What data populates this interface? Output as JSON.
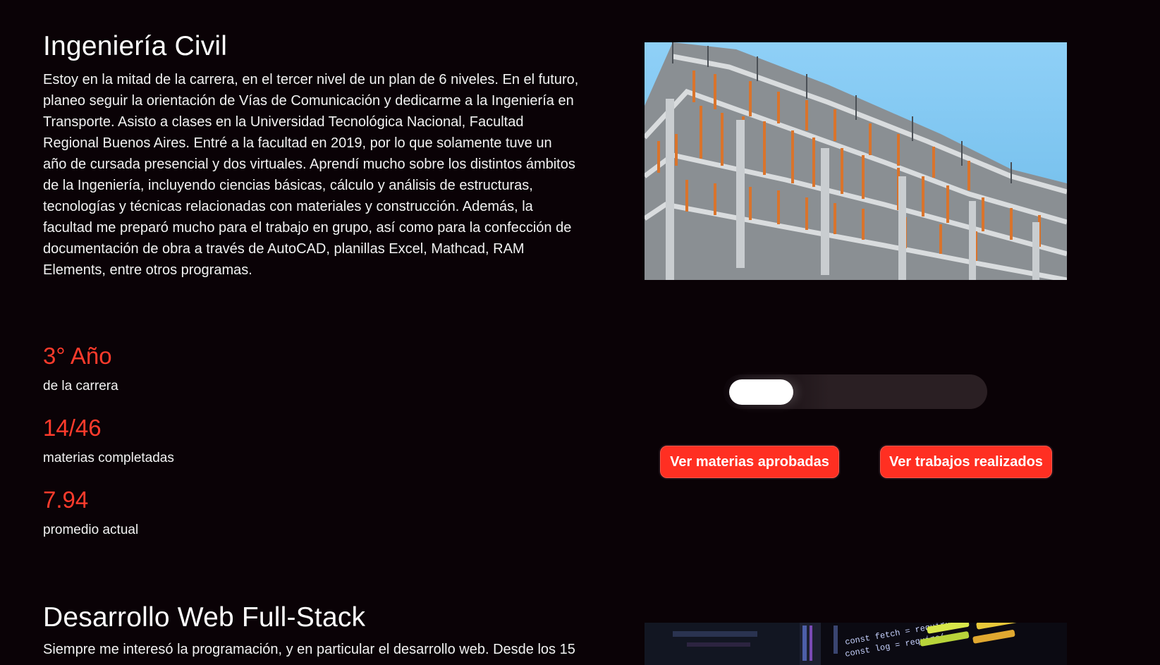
{
  "civil": {
    "title": "Ingeniería Civil",
    "description": "Estoy en la mitad de la carrera, en el tercer nivel de un plan de 6 niveles. En el futuro, planeo seguir la orientación de Vías de Comunicación y dedicarme a la Ingeniería en Transporte. Asisto a clases en la Universidad Tecnológica Nacional, Facultad Regional Buenos Aires. Entré a la facultad en 2019, por lo que solamente tuve un año de cursada presencial y dos virtuales. Aprendí mucho sobre los distintos ámbitos de la Ingeniería, incluyendo ciencias básicas, cálculo y análisis de estructuras, tecnologías y técnicas relacionadas con materiales y construcción. Además, la facultad me preparó mucho para el trabajo en grupo, así como para la confección de documentación de obra a través de AutoCAD, planillas Excel, Mathcad, RAM Elements, entre otros programas.",
    "stats": [
      {
        "value": "3° Año",
        "label": "de la carrera"
      },
      {
        "value": "14/46",
        "label": "materias completadas"
      },
      {
        "value": "7.94",
        "label": "promedio actual"
      }
    ],
    "buttons": {
      "approved": "Ver materias aprobadas",
      "works": "Ver trabajos realizados"
    },
    "toggle_on": false
  },
  "web": {
    "title": "Desarrollo Web Full-Stack",
    "description": "Siempre me interesó la programación, y en particular el desarrollo web. Desde los 15"
  },
  "code_snippet": {
    "line1": "const fetch = require(",
    "line2": "const log = require("
  },
  "colors": {
    "accent": "#ff2f22",
    "background": "#0a0206"
  }
}
